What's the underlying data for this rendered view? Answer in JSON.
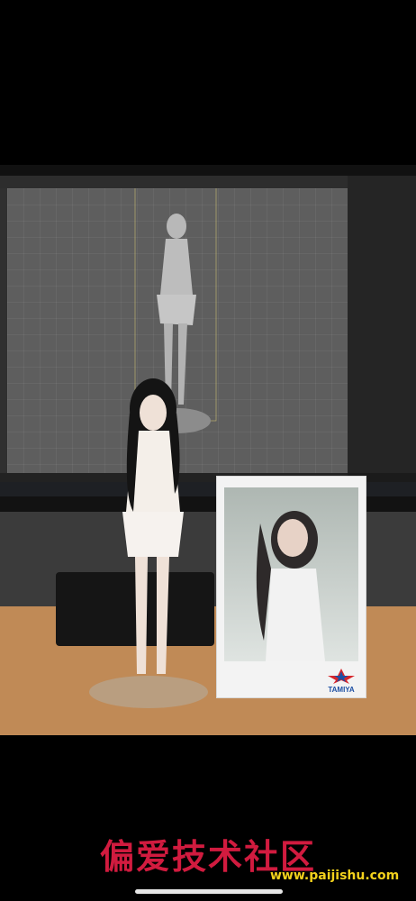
{
  "scene": {
    "description_visible": "",
    "monitor": {
      "viewport_label": "",
      "title_bar": ""
    },
    "product_box": {
      "small_text": "",
      "brand": "TAMIYA"
    }
  },
  "watermark": {
    "chinese": "偏爱技术社区",
    "url": "www.paijishu.com"
  },
  "colors": {
    "wall": "#3b3b3b",
    "desk": "#c08a56",
    "watermark_red": "#d11b3f",
    "watermark_yellow": "#f3d11c",
    "tamiya_blue": "#1d4fa3",
    "tamiya_red": "#d6252b"
  }
}
